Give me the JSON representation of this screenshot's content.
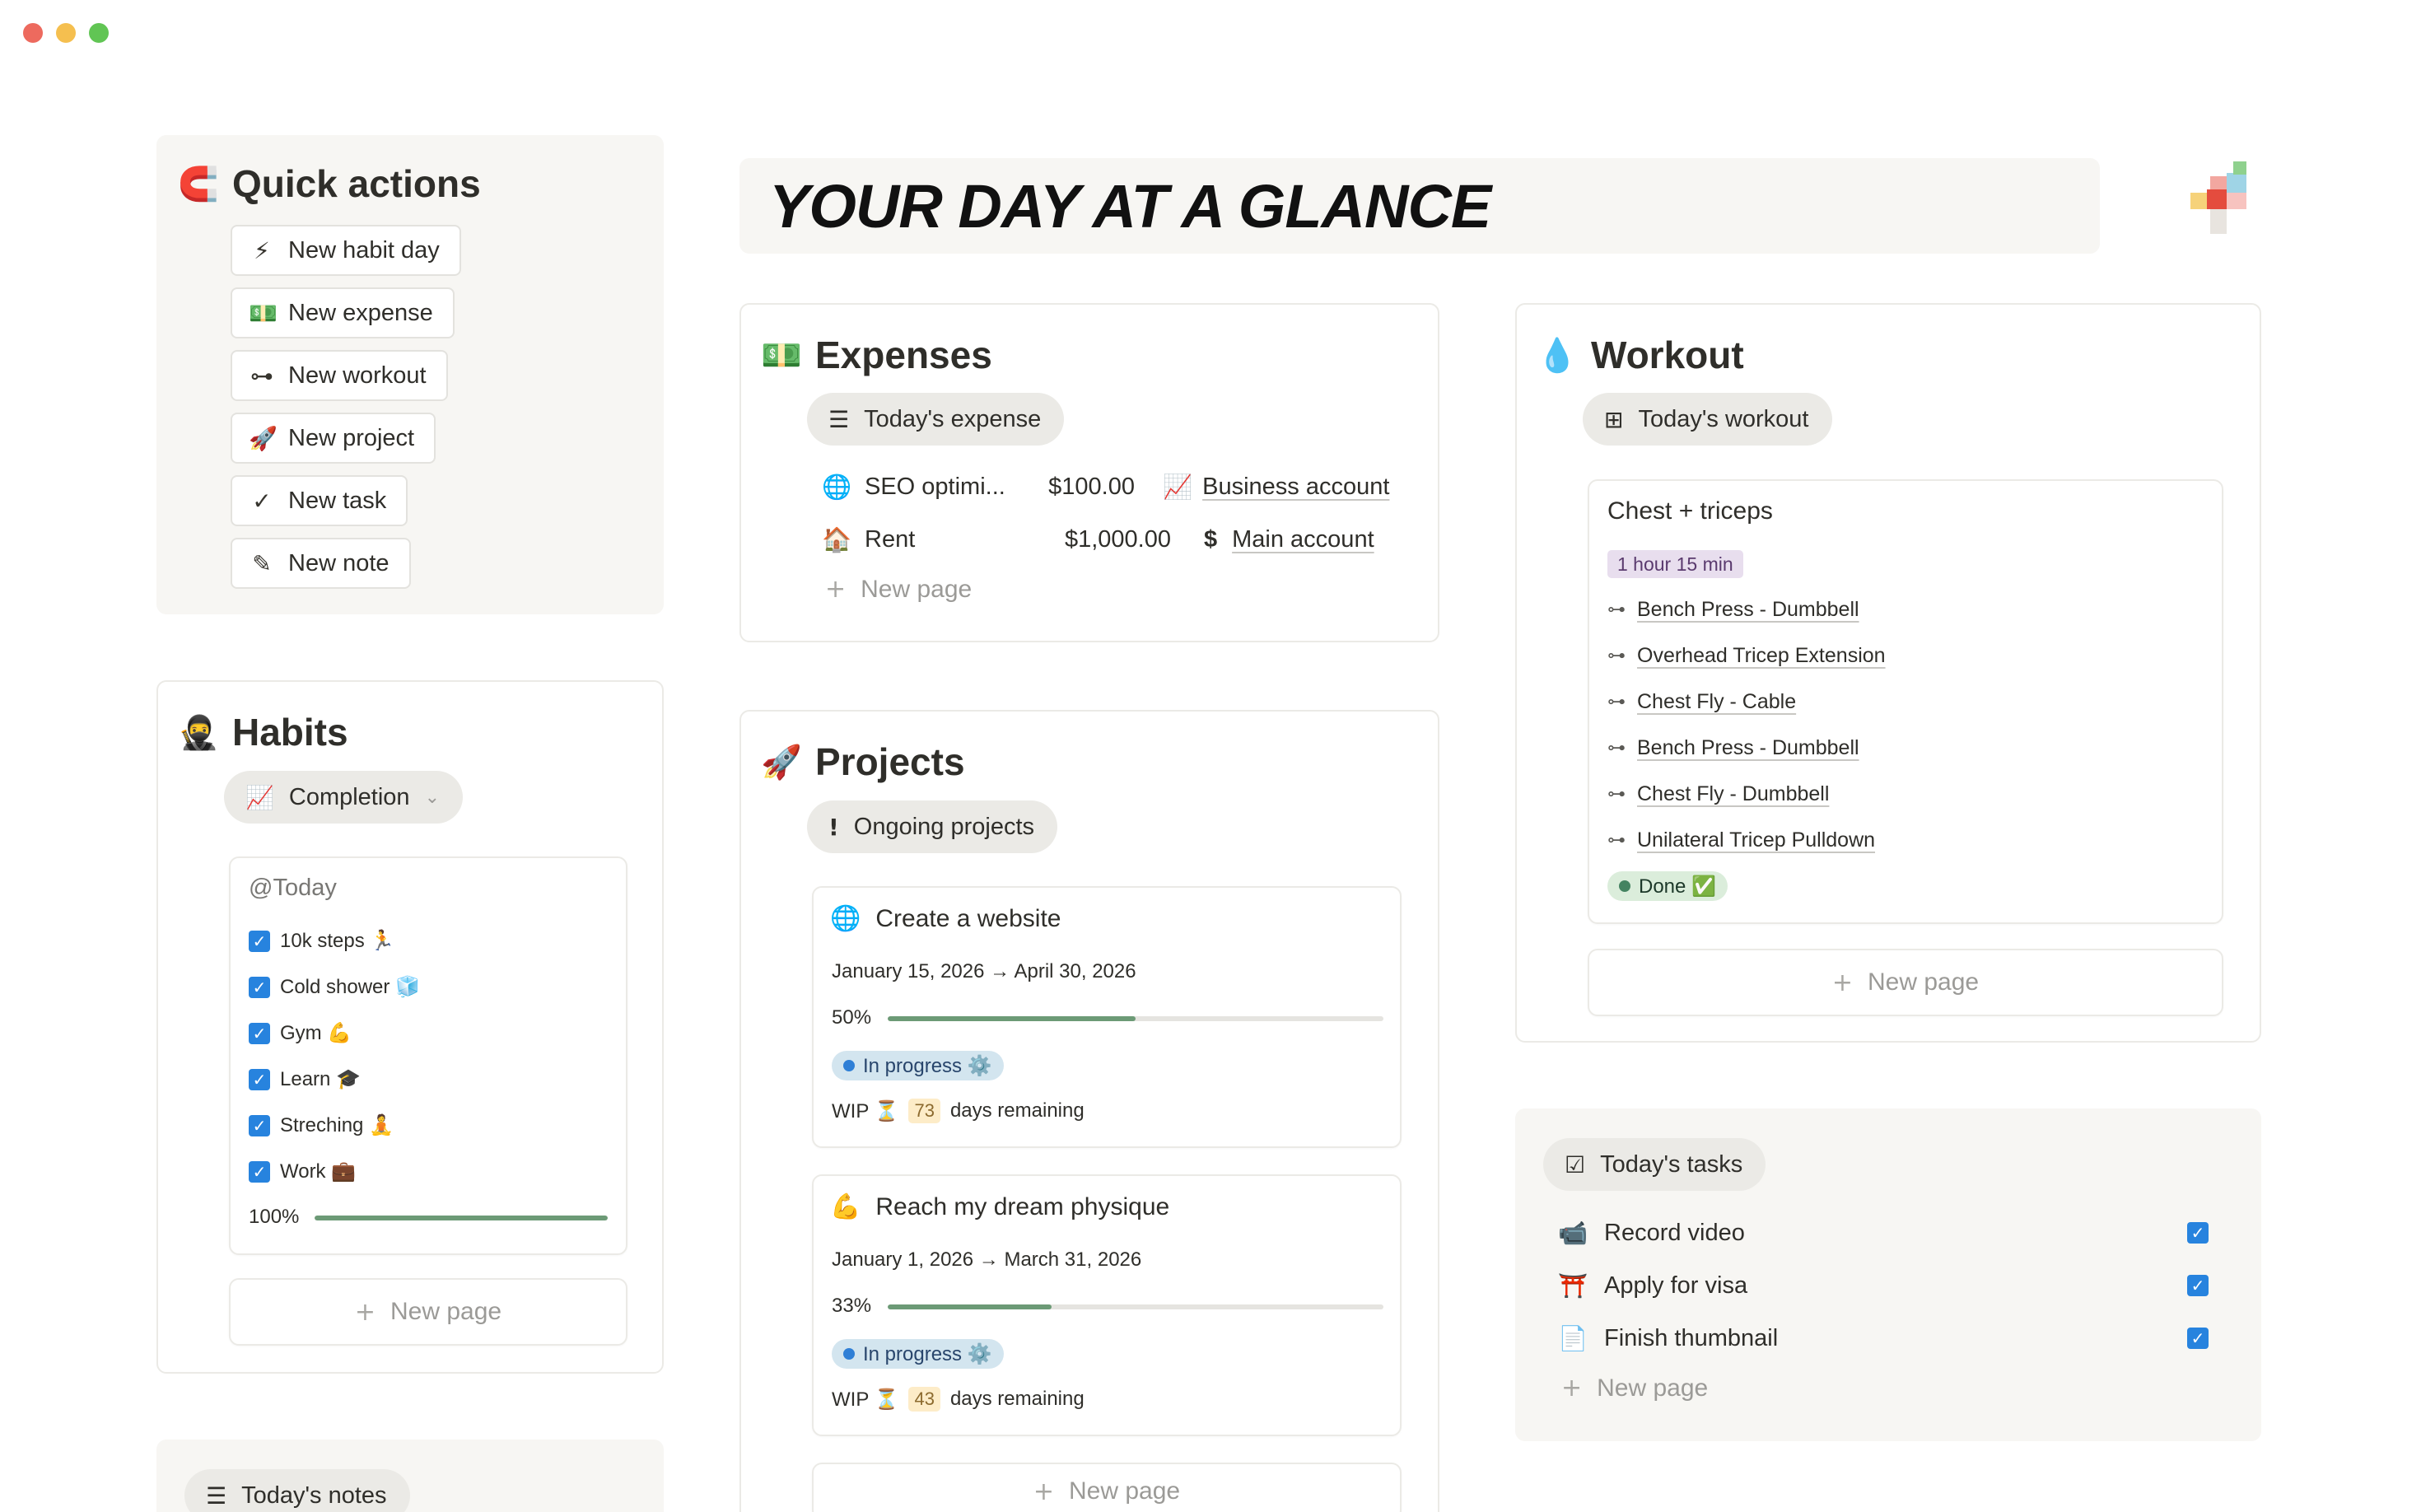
{
  "window": {
    "controls": [
      "close",
      "minimize",
      "maximize"
    ]
  },
  "header": {
    "title": "YOUR DAY AT A GLANCE",
    "logo_icon": "plus-logo-icon"
  },
  "quick_actions": {
    "emoji": "🧲",
    "title": "Quick actions",
    "buttons": [
      {
        "icon": "lightning-icon",
        "glyph": "⚡",
        "label": "New habit day"
      },
      {
        "icon": "money-icon",
        "glyph": "💵",
        "label": "New expense"
      },
      {
        "icon": "dumbbell-icon",
        "glyph": "🏋",
        "label": "New workout"
      },
      {
        "icon": "rocket-icon",
        "glyph": "🚀",
        "label": "New project"
      },
      {
        "icon": "check-icon",
        "glyph": "✓",
        "label": "New task"
      },
      {
        "icon": "pencil-icon",
        "glyph": "✎",
        "label": "New note"
      }
    ]
  },
  "habits": {
    "emoji": "🥷",
    "title": "Habits",
    "view": {
      "icon": "line-chart-icon",
      "label": "Completion"
    },
    "card": {
      "date": "@Today",
      "items": [
        {
          "label": "10k steps 🏃",
          "checked": true
        },
        {
          "label": "Cold shower 🧊",
          "checked": true
        },
        {
          "label": "Gym 💪",
          "checked": true
        },
        {
          "label": "Learn 🎓",
          "checked": true
        },
        {
          "label": "Streching 🧘",
          "checked": true
        },
        {
          "label": "Work 💼",
          "checked": true
        }
      ],
      "progress_label": "100%",
      "progress": 1.0
    },
    "new_page": "New page"
  },
  "notes": {
    "view": {
      "icon": "list-icon",
      "label": "Today's notes"
    }
  },
  "expenses": {
    "emoji": "💵",
    "title": "Expenses",
    "view": {
      "icon": "list-icon",
      "label": "Today's expense"
    },
    "rows": [
      {
        "emoji": "🌐",
        "name": "SEO optimi...",
        "amount": "$100.00",
        "account_emoji": "📈",
        "account": "Business account"
      },
      {
        "emoji": "🏠",
        "name": "Rent",
        "amount": "$1,000.00",
        "account_emoji": "$",
        "account": "Main account"
      }
    ],
    "new_page": "New page"
  },
  "projects": {
    "emoji": "🚀",
    "title": "Projects",
    "view": {
      "icon": "exclamation-icon",
      "label": "Ongoing projects"
    },
    "items": [
      {
        "emoji": "🌐",
        "name": "Create a website",
        "dates": "January 15, 2026 → April 30, 2026",
        "progress_label": "50%",
        "progress": 0.5,
        "status": "In progress ⚙️",
        "wip_prefix": "WIP ⏳",
        "days": "73",
        "wip_suffix": "days remaining"
      },
      {
        "emoji": "💪",
        "name": "Reach my dream physique",
        "dates": "January 1, 2026 → March 31, 2026",
        "progress_label": "33%",
        "progress": 0.33,
        "status": "In progress ⚙️",
        "wip_prefix": "WIP ⏳",
        "days": "43",
        "wip_suffix": "days remaining"
      }
    ],
    "new_page": "New page"
  },
  "workout": {
    "emoji": "💧",
    "title": "Workout",
    "view": {
      "icon": "gallery-icon",
      "label": "Today's workout"
    },
    "card": {
      "title": "Chest + triceps",
      "duration": "1 hour 15 min",
      "exercises": [
        "Bench Press - Dumbbell",
        "Overhead Tricep Extension",
        "Chest Fly - Cable",
        "Bench Press - Dumbbell",
        "Chest Fly - Dumbbell",
        "Unilateral Tricep Pulldown"
      ],
      "status": "Done ✅"
    },
    "new_page": "New page"
  },
  "tasks": {
    "view": {
      "icon": "checklist-icon",
      "label": "Today's tasks"
    },
    "items": [
      {
        "emoji": "📹",
        "label": "Record video",
        "checked": true
      },
      {
        "emoji": "⛩️",
        "label": "Apply for visa",
        "checked": true
      },
      {
        "emoji": "📄",
        "label": "Finish thumbnail",
        "checked": true
      }
    ],
    "new_page": "New page"
  },
  "colors": {
    "accent_blue": "#2783de",
    "progress_green": "#6c9a76",
    "panel_gray": "#f7f6f3",
    "status_blue": "#d3e5ef",
    "duration_purple": "#e8deee",
    "done_green": "#dbeddb"
  }
}
